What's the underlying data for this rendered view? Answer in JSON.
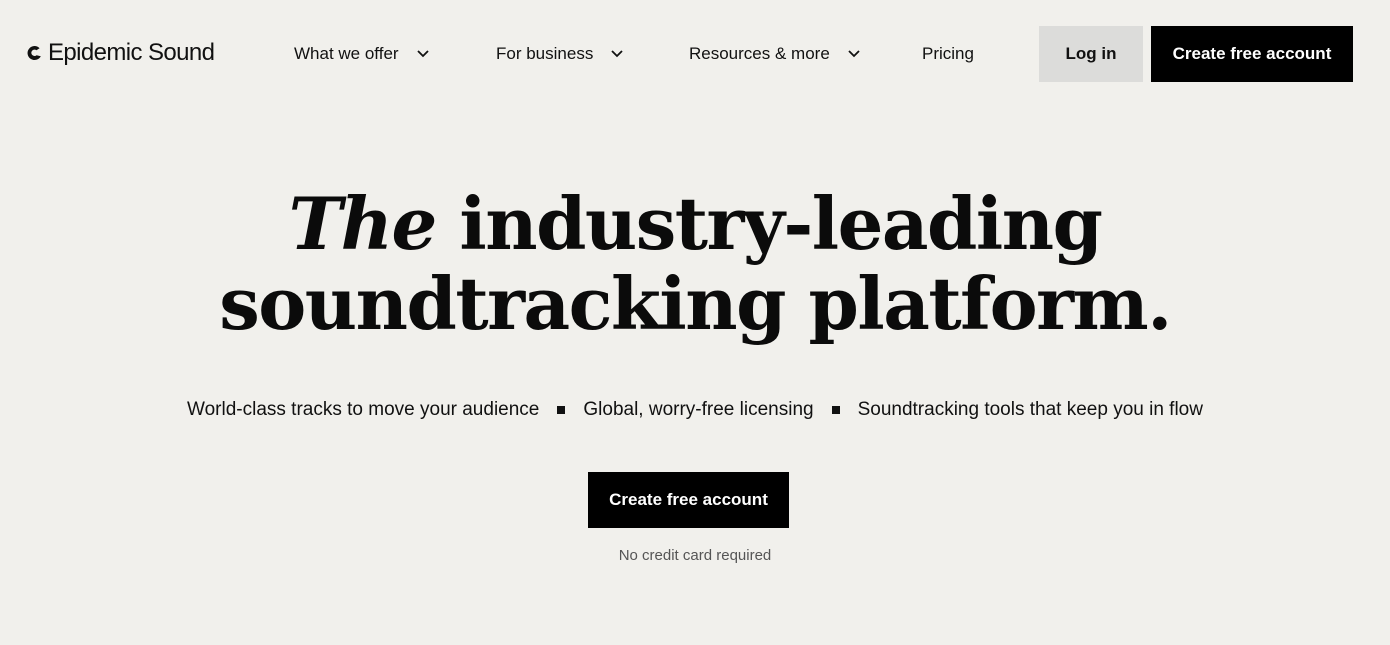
{
  "brand": {
    "name": "Epidemic Sound",
    "logo_icon": "epidemic-sound-logo-mark"
  },
  "nav": {
    "items": [
      {
        "label": "What we offer",
        "icon": "chevron-down-icon"
      },
      {
        "label": "For business",
        "icon": "chevron-down-icon"
      },
      {
        "label": "Resources & more",
        "icon": "chevron-down-icon"
      },
      {
        "label": "Pricing"
      }
    ],
    "login_label": "Log in",
    "create_label": "Create free account"
  },
  "hero": {
    "title_em": "The",
    "title_rest": "industry-leading",
    "title_line2": "soundtracking platform.",
    "features": [
      "World-class tracks to move your audience",
      "Global, worry-free licensing",
      "Soundtracking tools that keep you in flow"
    ],
    "cta_label": "Create free account",
    "cta_note": "No credit card required"
  },
  "colors": {
    "background": "#f1f0ec",
    "primary_button": "#000000",
    "secondary_button": "#dcdcda",
    "text": "#111111"
  }
}
